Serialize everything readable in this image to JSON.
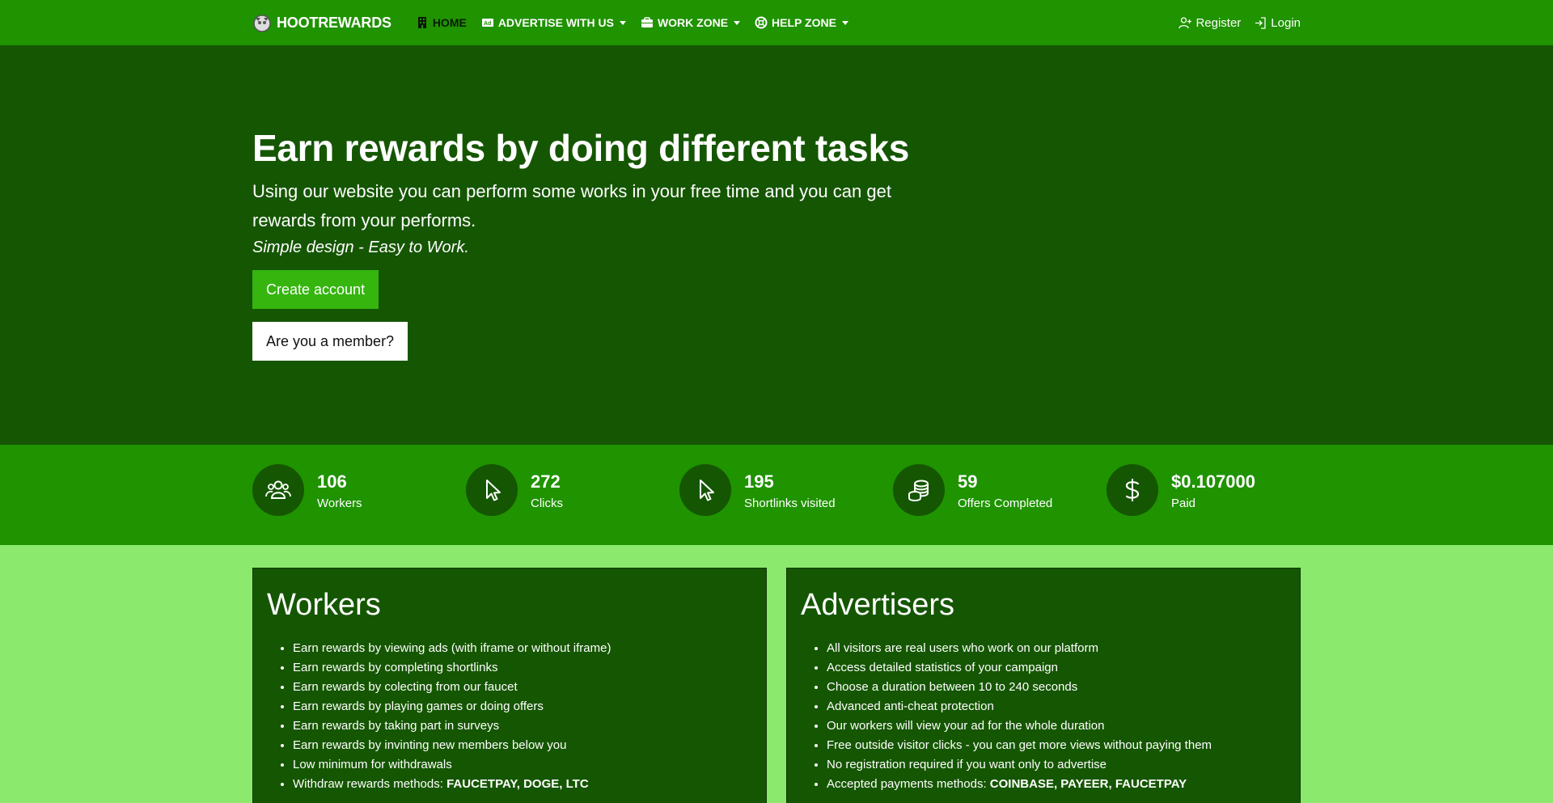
{
  "navbar": {
    "brand": "HOOTREWARDS",
    "items": [
      {
        "label": "HOME",
        "icon": "building-icon",
        "active": true,
        "dropdown": false
      },
      {
        "label": "ADVERTISE WITH US",
        "icon": "ad-icon",
        "active": false,
        "dropdown": true
      },
      {
        "label": "WORK ZONE",
        "icon": "briefcase-icon",
        "active": false,
        "dropdown": true
      },
      {
        "label": "HELP ZONE",
        "icon": "lifebuoy-icon",
        "active": false,
        "dropdown": true
      }
    ],
    "register": "Register",
    "login": "Login"
  },
  "hero": {
    "title": "Earn rewards by doing different tasks",
    "lead": "Using our website you can perform some works in your free time and you can get rewards from your performs.",
    "tagline": "Simple design - Easy to Work.",
    "create_account": "Create account",
    "member": "Are you a member?"
  },
  "stats": [
    {
      "value": "106",
      "label": "Workers",
      "icon": "users-icon"
    },
    {
      "value": "272",
      "label": "Clicks",
      "icon": "cursor-icon"
    },
    {
      "value": "195",
      "label": "Shortlinks visited",
      "icon": "cursor-icon"
    },
    {
      "value": "59",
      "label": "Offers Completed",
      "icon": "coins-icon"
    },
    {
      "value": "$0.107000",
      "label": "Paid",
      "icon": "dollar-icon"
    }
  ],
  "workers": {
    "title": "Workers",
    "items": [
      "Earn rewards by viewing ads (with iframe or without iframe)",
      "Earn rewards by completing shortlinks",
      "Earn rewards by colecting from our faucet",
      "Earn rewards by playing games or doing offers",
      "Earn rewards by taking part in surveys",
      "Earn rewards by invinting new members below you",
      "Low minimum for withdrawals"
    ],
    "methods_label": "Withdraw rewards methods: ",
    "methods_value": "FAUCETPAY, DOGE, LTC"
  },
  "advertisers": {
    "title": "Advertisers",
    "items": [
      "All visitors are real users who work on our platform",
      "Access detailed statistics of your campaign",
      "Choose a duration between 10 to 240 seconds",
      "Advanced anti-cheat protection",
      "Our workers will view your ad for the whole duration",
      "Free outside visitor clicks - you can get more views without paying them",
      "No registration required if you want only to advertise"
    ],
    "methods_label": "Accepted payments methods: ",
    "methods_value": "COINBASE, PAYEER, FAUCETPAY"
  },
  "colors": {
    "nav_green": "#1f9300",
    "hero_green": "#155602",
    "page_green": "#8be96e",
    "button_green": "#35b50e"
  }
}
